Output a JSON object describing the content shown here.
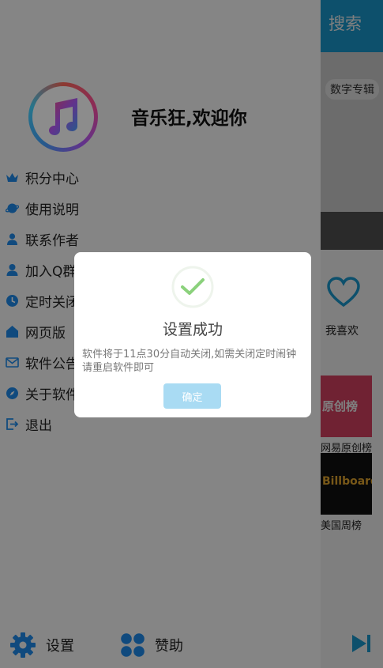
{
  "background": {
    "search_label": "搜索",
    "album_chip": "数字专辑",
    "favorites_label": "我喜欢",
    "chart_tile1_text": "原创榜",
    "chart_tile1_label": "网易原创榜",
    "chart_tile2_text": "Billboard",
    "chart_tile2_label": "美国周榜"
  },
  "drawer": {
    "welcome": "音乐狂,欢迎你",
    "menu": [
      {
        "label": "积分中心",
        "icon": "crown-icon"
      },
      {
        "label": "使用说明",
        "icon": "planet-icon"
      },
      {
        "label": "联系作者",
        "icon": "person-icon"
      },
      {
        "label": "加入Q群",
        "icon": "group-icon"
      },
      {
        "label": "定时关闭",
        "icon": "clock-icon"
      },
      {
        "label": "网页版",
        "icon": "home-icon"
      },
      {
        "label": "软件公告",
        "icon": "mail-icon"
      },
      {
        "label": "关于软件",
        "icon": "compass-icon"
      },
      {
        "label": "退出",
        "icon": "exit-icon"
      }
    ],
    "bottom": {
      "settings_label": "设置",
      "donate_label": "赞助"
    }
  },
  "dialog": {
    "title": "设置成功",
    "message": "软件将于11点30分自动关闭,如需关闭定时闹钟请重启软件即可",
    "confirm_label": "确定"
  },
  "colors": {
    "accent": "#1aa0d8",
    "icon_blue": "#1e88e5",
    "success_green": "#8bd17c",
    "confirm_button": "#a9dbf3"
  }
}
